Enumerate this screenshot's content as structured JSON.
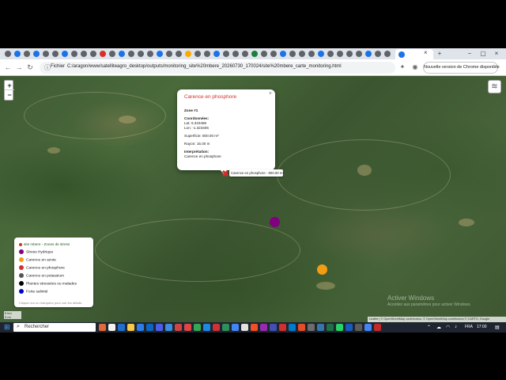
{
  "browser": {
    "url_label": "Fichier",
    "url": "C:/aragon/www/satelliteagro_desktop/outputs/monitoring_site%20mbere_20260730_170024/site%20mbere_carte_monitoring.html",
    "update_button": "Nouvelle version de Chrome disponible"
  },
  "map": {
    "zoom_in": "+",
    "zoom_out": "−",
    "popup": {
      "title": "Carence en phosphore",
      "close": "×",
      "zone": "Zone #1",
      "coords_label": "Coordonnées:",
      "lat": "Lat: 6.323486",
      "lon": "Lon: -1.323406",
      "superficie": "Superficie: 800.00 m²",
      "rayon": "Rayon: 15.00 m",
      "interp_label": "Interprétation:",
      "interp_value": "Carence en phosphore"
    },
    "tooltip": "Carence en phosphore - 800.00 m²",
    "legend": {
      "title": "site mbere - Zones de stress",
      "items": [
        {
          "label": "Stress Hydrique",
          "color": "#800080"
        },
        {
          "label": "Carence en azote",
          "color": "#f39c12"
        },
        {
          "label": "Carence en phosphore",
          "color": "#d32f2f"
        },
        {
          "label": "Carence en potassium",
          "color": "#555555"
        },
        {
          "label": "Plantes stressées ou malades",
          "color": "#000000"
        },
        {
          "label": "Forte salinité",
          "color": "#0000cc"
        }
      ],
      "hint": "Cliquez sur un marqueur pour voir les détails"
    },
    "scale": [
      "5 km",
      "3 mi"
    ],
    "attribution": "Leaflet | © OpenStreetMap contributors, © OpenStreetMap contributors © CARTO, Google",
    "watermark_title": "Activer Windows",
    "watermark_sub": "Accédez aux paramètres pour activer Windows."
  },
  "taskbar": {
    "search_placeholder": "Rechercher",
    "lang": "FRA",
    "time": "17:00"
  },
  "colors": {
    "marker_purple": "#800080",
    "marker_orange": "#f39c12",
    "marker_red": "#d32f2f"
  }
}
